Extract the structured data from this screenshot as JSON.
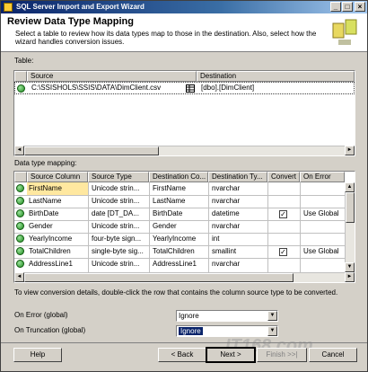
{
  "window": {
    "title": "SQL Server Import and Export Wizard"
  },
  "header": {
    "title": "Review Data Type Mapping",
    "subtitle": "Select a table to review how its data types map to those in the destination. Also, select how the wizard handles conversion issues."
  },
  "table_section": {
    "label": "Table:",
    "columns": [
      "Source",
      "Destination"
    ],
    "rows": [
      {
        "source": "C:\\SSISHOLS\\SSIS\\DATA\\DimClient.csv",
        "destination": "[dbo].[DimClient]"
      }
    ]
  },
  "mapping_section": {
    "label": "Data type mapping:",
    "columns": [
      "Source Column",
      "Source Type",
      "Destination Co...",
      "Destination Ty...",
      "Convert",
      "On Error"
    ],
    "rows": [
      {
        "source_column": "FirstName",
        "source_type": "Unicode strin...",
        "dest_column": "FirstName",
        "dest_type": "nvarchar",
        "convert": false,
        "on_error": ""
      },
      {
        "source_column": "LastName",
        "source_type": "Unicode strin...",
        "dest_column": "LastName",
        "dest_type": "nvarchar",
        "convert": false,
        "on_error": ""
      },
      {
        "source_column": "BirthDate",
        "source_type": "date [DT_DA...",
        "dest_column": "BirthDate",
        "dest_type": "datetime",
        "convert": true,
        "on_error": "Use Global"
      },
      {
        "source_column": "Gender",
        "source_type": "Unicode strin...",
        "dest_column": "Gender",
        "dest_type": "nvarchar",
        "convert": false,
        "on_error": ""
      },
      {
        "source_column": "YearlyIncome",
        "source_type": "four-byte sign...",
        "dest_column": "YearlyIncome",
        "dest_type": "int",
        "convert": false,
        "on_error": ""
      },
      {
        "source_column": "TotalChildren",
        "source_type": "single-byte sig...",
        "dest_column": "TotalChildren",
        "dest_type": "smallint",
        "convert": true,
        "on_error": "Use Global"
      },
      {
        "source_column": "AddressLine1",
        "source_type": "Unicode strin...",
        "dest_column": "AddressLine1",
        "dest_type": "nvarchar",
        "convert": false,
        "on_error": ""
      }
    ]
  },
  "hint": "To view conversion details, double-click the row that contains the column source type to be converted.",
  "on_error_global": {
    "label": "On Error (global)",
    "value": "Ignore"
  },
  "on_truncation_global": {
    "label": "On Truncation (global)",
    "value": "Ignore"
  },
  "buttons": {
    "help": "Help",
    "back": "< Back",
    "next": "Next >",
    "finish": "Finish >>|",
    "cancel": "Cancel"
  },
  "watermark": "IT168.com"
}
